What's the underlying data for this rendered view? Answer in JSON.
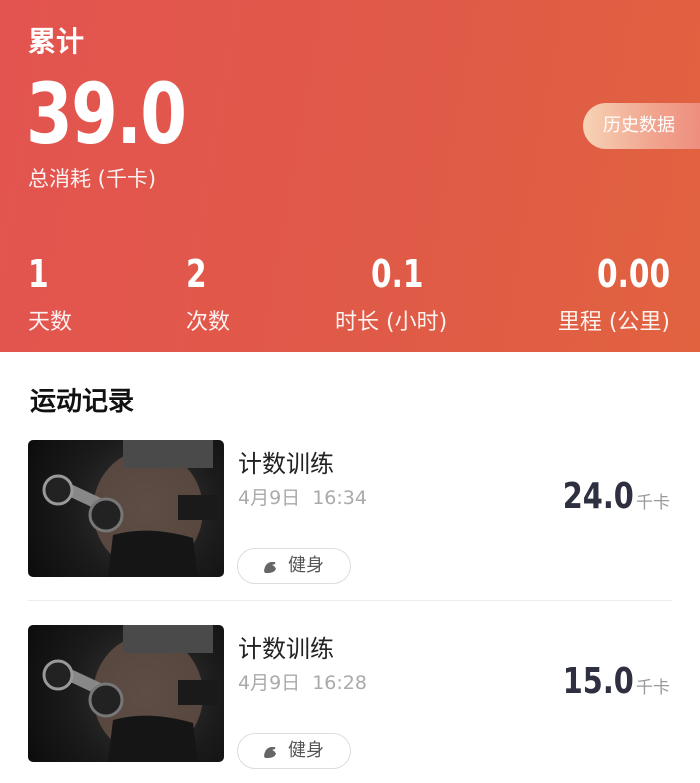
{
  "summary": {
    "title": "累计",
    "total_value": "39.0",
    "total_label": "总消耗 (千卡)",
    "history_button": "历史数据",
    "stats": [
      {
        "value": "1",
        "label": "天数"
      },
      {
        "value": "2",
        "label": "次数"
      },
      {
        "value": "0.1",
        "label": "时长 (小时)"
      },
      {
        "value": "0.00",
        "label": "里程 (公里)"
      }
    ]
  },
  "records": {
    "section_title": "运动记录",
    "items": [
      {
        "name": "计数训练",
        "time": "4月9日 16:34",
        "tag": "健身",
        "kcal": "24.0",
        "unit": "千卡"
      },
      {
        "name": "计数训练",
        "time": "4月9日 16:28",
        "tag": "健身",
        "kcal": "15.0",
        "unit": "千卡"
      }
    ]
  },
  "colors": {
    "header_red": "#e35450",
    "history_gradient_start": "#f6d3b5",
    "kcal_text": "#2e3042"
  },
  "icons": {
    "tag_icon": "dumbbell-arm-icon"
  }
}
